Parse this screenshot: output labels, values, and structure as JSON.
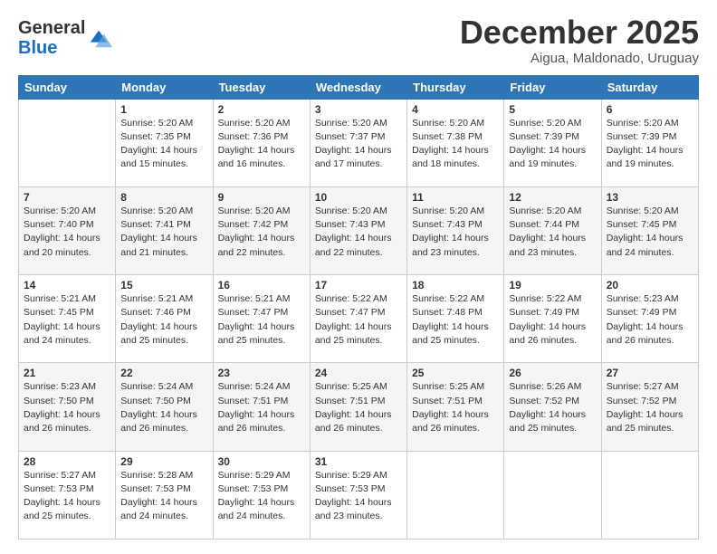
{
  "logo": {
    "general": "General",
    "blue": "Blue"
  },
  "title": "December 2025",
  "location": "Aigua, Maldonado, Uruguay",
  "days_of_week": [
    "Sunday",
    "Monday",
    "Tuesday",
    "Wednesday",
    "Thursday",
    "Friday",
    "Saturday"
  ],
  "weeks": [
    [
      {
        "day": "",
        "info": ""
      },
      {
        "day": "1",
        "info": "Sunrise: 5:20 AM\nSunset: 7:35 PM\nDaylight: 14 hours\nand 15 minutes."
      },
      {
        "day": "2",
        "info": "Sunrise: 5:20 AM\nSunset: 7:36 PM\nDaylight: 14 hours\nand 16 minutes."
      },
      {
        "day": "3",
        "info": "Sunrise: 5:20 AM\nSunset: 7:37 PM\nDaylight: 14 hours\nand 17 minutes."
      },
      {
        "day": "4",
        "info": "Sunrise: 5:20 AM\nSunset: 7:38 PM\nDaylight: 14 hours\nand 18 minutes."
      },
      {
        "day": "5",
        "info": "Sunrise: 5:20 AM\nSunset: 7:39 PM\nDaylight: 14 hours\nand 19 minutes."
      },
      {
        "day": "6",
        "info": "Sunrise: 5:20 AM\nSunset: 7:39 PM\nDaylight: 14 hours\nand 19 minutes."
      }
    ],
    [
      {
        "day": "7",
        "info": "Sunrise: 5:20 AM\nSunset: 7:40 PM\nDaylight: 14 hours\nand 20 minutes."
      },
      {
        "day": "8",
        "info": "Sunrise: 5:20 AM\nSunset: 7:41 PM\nDaylight: 14 hours\nand 21 minutes."
      },
      {
        "day": "9",
        "info": "Sunrise: 5:20 AM\nSunset: 7:42 PM\nDaylight: 14 hours\nand 22 minutes."
      },
      {
        "day": "10",
        "info": "Sunrise: 5:20 AM\nSunset: 7:43 PM\nDaylight: 14 hours\nand 22 minutes."
      },
      {
        "day": "11",
        "info": "Sunrise: 5:20 AM\nSunset: 7:43 PM\nDaylight: 14 hours\nand 23 minutes."
      },
      {
        "day": "12",
        "info": "Sunrise: 5:20 AM\nSunset: 7:44 PM\nDaylight: 14 hours\nand 23 minutes."
      },
      {
        "day": "13",
        "info": "Sunrise: 5:20 AM\nSunset: 7:45 PM\nDaylight: 14 hours\nand 24 minutes."
      }
    ],
    [
      {
        "day": "14",
        "info": "Sunrise: 5:21 AM\nSunset: 7:45 PM\nDaylight: 14 hours\nand 24 minutes."
      },
      {
        "day": "15",
        "info": "Sunrise: 5:21 AM\nSunset: 7:46 PM\nDaylight: 14 hours\nand 25 minutes."
      },
      {
        "day": "16",
        "info": "Sunrise: 5:21 AM\nSunset: 7:47 PM\nDaylight: 14 hours\nand 25 minutes."
      },
      {
        "day": "17",
        "info": "Sunrise: 5:22 AM\nSunset: 7:47 PM\nDaylight: 14 hours\nand 25 minutes."
      },
      {
        "day": "18",
        "info": "Sunrise: 5:22 AM\nSunset: 7:48 PM\nDaylight: 14 hours\nand 25 minutes."
      },
      {
        "day": "19",
        "info": "Sunrise: 5:22 AM\nSunset: 7:49 PM\nDaylight: 14 hours\nand 26 minutes."
      },
      {
        "day": "20",
        "info": "Sunrise: 5:23 AM\nSunset: 7:49 PM\nDaylight: 14 hours\nand 26 minutes."
      }
    ],
    [
      {
        "day": "21",
        "info": "Sunrise: 5:23 AM\nSunset: 7:50 PM\nDaylight: 14 hours\nand 26 minutes."
      },
      {
        "day": "22",
        "info": "Sunrise: 5:24 AM\nSunset: 7:50 PM\nDaylight: 14 hours\nand 26 minutes."
      },
      {
        "day": "23",
        "info": "Sunrise: 5:24 AM\nSunset: 7:51 PM\nDaylight: 14 hours\nand 26 minutes."
      },
      {
        "day": "24",
        "info": "Sunrise: 5:25 AM\nSunset: 7:51 PM\nDaylight: 14 hours\nand 26 minutes."
      },
      {
        "day": "25",
        "info": "Sunrise: 5:25 AM\nSunset: 7:51 PM\nDaylight: 14 hours\nand 26 minutes."
      },
      {
        "day": "26",
        "info": "Sunrise: 5:26 AM\nSunset: 7:52 PM\nDaylight: 14 hours\nand 25 minutes."
      },
      {
        "day": "27",
        "info": "Sunrise: 5:27 AM\nSunset: 7:52 PM\nDaylight: 14 hours\nand 25 minutes."
      }
    ],
    [
      {
        "day": "28",
        "info": "Sunrise: 5:27 AM\nSunset: 7:53 PM\nDaylight: 14 hours\nand 25 minutes."
      },
      {
        "day": "29",
        "info": "Sunrise: 5:28 AM\nSunset: 7:53 PM\nDaylight: 14 hours\nand 24 minutes."
      },
      {
        "day": "30",
        "info": "Sunrise: 5:29 AM\nSunset: 7:53 PM\nDaylight: 14 hours\nand 24 minutes."
      },
      {
        "day": "31",
        "info": "Sunrise: 5:29 AM\nSunset: 7:53 PM\nDaylight: 14 hours\nand 23 minutes."
      },
      {
        "day": "",
        "info": ""
      },
      {
        "day": "",
        "info": ""
      },
      {
        "day": "",
        "info": ""
      }
    ]
  ]
}
